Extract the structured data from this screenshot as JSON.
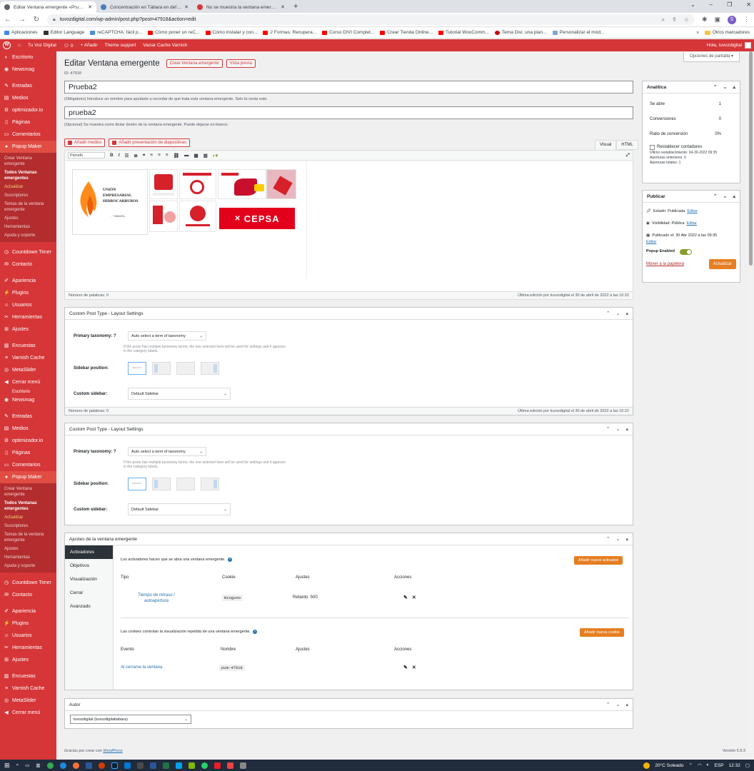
{
  "browser": {
    "tabs": [
      {
        "title": "Editar Ventana emergente «Prue…",
        "active": true,
        "color": "#5f6368"
      },
      {
        "title": "Concentración en Tábara en defe…",
        "active": false,
        "color": "#4a7ebb"
      },
      {
        "title": "No se muestra la ventana emerge…",
        "active": false,
        "color": "#d63638"
      }
    ],
    "url": "tuvozdigital.com/wp-admin/post.php?post=47918&action=edit",
    "bookmarks": [
      {
        "label": "Aplicaciones",
        "color": "#4285f4"
      },
      {
        "label": "Editor Language",
        "color": "#333333"
      },
      {
        "label": "reCAPTCHA: fácil p...",
        "color": "#4a90d9"
      },
      {
        "label": "Cómo poner un reC...",
        "color": "#ff0000"
      },
      {
        "label": "Cómo instalar y con...",
        "color": "#ff0000"
      },
      {
        "label": "2 Formas: Recupera...",
        "color": "#ff0000"
      },
      {
        "label": "Curso DIVI Complet...",
        "color": "#ff0000"
      },
      {
        "label": "Crear Tienda Online...",
        "color": "#ff0000"
      },
      {
        "label": "Tutorial WooComm...",
        "color": "#ff0000"
      },
      {
        "label": "Tema Divi, una plan...",
        "color": "#cc0000"
      },
      {
        "label": "Personalizar el mód...",
        "color": "#7aa7d6"
      }
    ],
    "bookmarks_more": "»",
    "other_bookmarks": "Otros marcadores",
    "profile_initial": "S"
  },
  "adminbar": {
    "site": "Tu Voz Digital",
    "comments": "0",
    "add": "Añadir",
    "theme_support": "Theme support",
    "varnish": "Vaciar Cache Varnish",
    "greeting": "Hola, tuvozdigital"
  },
  "sidebar": {
    "group1": [
      {
        "label": "Escritorio",
        "icon": "dashboard-icon"
      },
      {
        "label": "Newsmag",
        "icon": "eye-icon"
      }
    ],
    "group2": [
      {
        "label": "Entradas",
        "icon": "pin-icon"
      },
      {
        "label": "Medios",
        "icon": "media-icon"
      },
      {
        "label": "optimizador.io",
        "icon": "gear-icon"
      },
      {
        "label": "Páginas",
        "icon": "page-icon"
      },
      {
        "label": "Comentarios",
        "icon": "comment-icon"
      }
    ],
    "popup_maker": "Popup Maker",
    "submenu": [
      {
        "label": "Crear Ventana emergente",
        "style": ""
      },
      {
        "label": "Todos Ventanas emergentes",
        "style": "bold"
      },
      {
        "label": "Actualizar",
        "style": "hl"
      },
      {
        "label": "Suscriptores",
        "style": ""
      },
      {
        "label": "Temas de la ventana emergente",
        "style": ""
      },
      {
        "label": "Ajustes",
        "style": ""
      },
      {
        "label": "Herramientas",
        "style": ""
      },
      {
        "label": "Ayuda y soporte",
        "style": ""
      }
    ],
    "group3": [
      {
        "label": "Countdown Timer",
        "icon": "clock-icon"
      },
      {
        "label": "Contacto",
        "icon": "mail-icon"
      }
    ],
    "group4": [
      {
        "label": "Apariencia",
        "icon": "brush-icon"
      },
      {
        "label": "Plugins",
        "icon": "plugin-icon"
      },
      {
        "label": "Usuarios",
        "icon": "user-icon"
      },
      {
        "label": "Herramientas",
        "icon": "wrench-icon"
      },
      {
        "label": "Ajustes",
        "icon": "settings-icon"
      }
    ],
    "group5": [
      {
        "label": "Encuestas",
        "icon": "chart-icon"
      },
      {
        "label": "Varnish Cache",
        "icon": "cache-icon"
      },
      {
        "label": "MetaSlider",
        "icon": "slider-icon"
      },
      {
        "label": "Cerrar menú",
        "icon": "collapse-icon"
      }
    ],
    "cut_label": "Escritorio"
  },
  "page": {
    "screen_options": "Opciones de pantalla ▾",
    "heading": "Editar Ventana emergente",
    "create_btn": "Crear Ventana emergente",
    "preview_btn": "Vista previa",
    "post_id": "ID: 47918",
    "name_value": "Prueba2",
    "name_help": "(Obligatorio) Introduce un nombre para ayudarte a recordar de qué trata esta ventana emergente. Solo tú verás esto.",
    "title_value": "prueba2",
    "title_help": "(Opcional) Se muestra como titular dentro de la ventana emergente. Puede dejarse en blanco.",
    "add_media": "Añadir medios",
    "add_slideshow": "Añadir presentación de diapositivas",
    "tab_visual": "Visual",
    "tab_html": "HTML",
    "format_select": "Párrafo",
    "word_count": "Número de palabras: 0",
    "last_edit": "Última edición por tuvozdigital el 30 de abril de 2022 a las 10:22",
    "logo_line1": "UNIÓN",
    "logo_line2": "EMPRESARIAL",
    "logo_line3": "HIDROCARBUROS",
    "logo_sub": "- TÁBARA -",
    "cepsa": "CEPSA"
  },
  "layout_box": {
    "title": "Custom Post Type - Layout Settings",
    "primary_label": "Primary taxonomy:",
    "primary_help": "?",
    "primary_value": "Auto select a term of taxonomy",
    "primary_hint1": "If the posts has multiple taxonomy terms, the one selected here will be used for settings and it appears",
    "primary_hint2": "in the category labels.",
    "sidebar_pos_label": "Sidebar position:",
    "default_pos": "DEFAULT",
    "custom_sidebar_label": "Custom sidebar:",
    "custom_sidebar_value": "Default Sidebar"
  },
  "settings_box": {
    "title": "Ajustes de la ventana emergente",
    "tabs": [
      "Activadores",
      "Objetivos",
      "Visualización",
      "Cerrar",
      "Avanzado"
    ],
    "triggers_intro": "Los activadores hacen que se abra una ventana emergente.",
    "add_trigger": "Añadir nuevo activador",
    "trigger_cols": [
      "Tipo",
      "Cookie",
      "Ajustes",
      "Acciones"
    ],
    "trigger_row": {
      "type": "Tiempo de retraso / autoapertura",
      "cookie": "Ninguno",
      "settings": "Retardo: 500"
    },
    "cookies_intro": "Las cookies controlan la visualización repetida de una ventana emergente.",
    "add_cookie": "Añadir nueva cookie",
    "cookie_cols": [
      "Evento",
      "Nombre",
      "Ajustes",
      "Acciones"
    ],
    "cookie_row": {
      "event": "Al cerrarse la ventana",
      "name": "pum-47918"
    }
  },
  "author_box": {
    "title": "Autor",
    "value": "tuvozdigital (tuvozdigitaltabara)"
  },
  "analytics": {
    "title": "Analítica",
    "rows": [
      {
        "label": "Se abre",
        "value": "1"
      },
      {
        "label": "Conversiones",
        "value": "0"
      },
      {
        "label": "Ratio de conversión",
        "value": "0%"
      }
    ],
    "reset": "Restablecer contadores",
    "last_reset": "Último restablecimiento: 04-30-2022 09:35",
    "prev_opens": "Aperturas anteriores: 0",
    "total_opens": "Aperturas totales: 1"
  },
  "publish": {
    "title": "Publicar",
    "status": "Estado: Publicada",
    "visibility": "Visibilidad: Pública",
    "published": "Publicado el: 30 Abr 2022 a las 09:35",
    "edit": "Editar",
    "popup_enabled": "Popup Enabled",
    "trash": "Mover a la papelera",
    "update": "Actualizar"
  },
  "footer": {
    "thanks": "Gracias por crear con",
    "wp": "WordPress",
    "version": "Versión 5.9.3"
  },
  "taskbar": {
    "weather": "20°C Soleado",
    "lang": "ESP",
    "time": "12:32"
  }
}
